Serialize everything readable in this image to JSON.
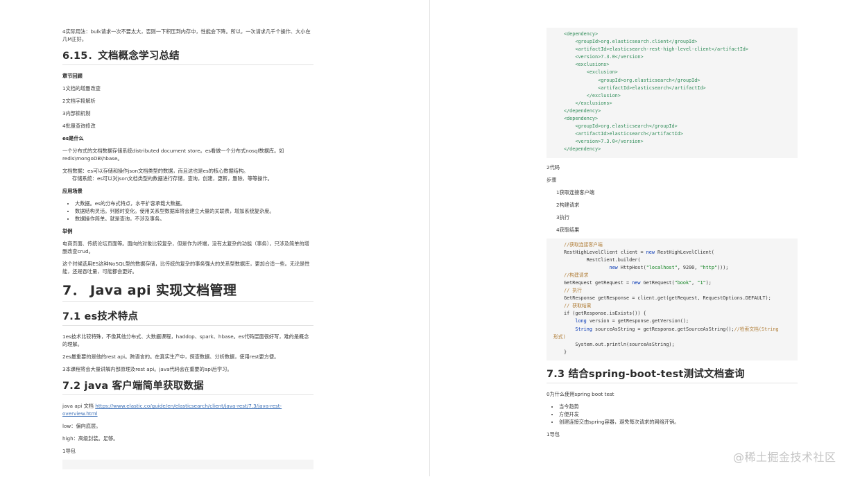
{
  "left": {
    "intro": "4实际用法：bulk请求一次不要太大，否则一下积压到内存中，性能会下降。所以，一次请求几千个操作、大小在几M正好。",
    "section_615": {
      "title": "6.15．文档概念学习总结",
      "recap_heading": "章节回顾",
      "recap_items": [
        "1文档的增删改查",
        "2文档字段解析",
        "3内部锁机制",
        "4批量查询修改"
      ],
      "what_heading": "es是什么",
      "what_p1": "一个分布式的文档数据存储系统distributed document store。es看做一个分布式nosql数据库。如redis\\mongoDB\\hbase。",
      "what_p2": "文档数据：es可以存储和操作json文档类型的数据，而且这也是es的核心数据结构。",
      "what_p3": "存储系统：es可以对json文档类型的数据进行存储，查询，创建，更新，删除，等等操作。",
      "scene_heading": "应用场景",
      "scene_items": [
        "大数据。es的分布式特点，水平扩容承载大数据。",
        "数据结构灵活。列随时变化。使用关系型数据库将会建立大量的关联表，增加系统复杂度。",
        "数据操作简单。就是查询，不涉及事务。"
      ],
      "example_heading": "举例",
      "example_p1": "电商页面、传统论坛页面等。面向的对象比较复杂，但是作为终端，没有太复杂的功能（事务），只涉及简单的增删改查crud。",
      "example_p2": "这个时候选用ES这种NoSQL型的数据存储，比传统的复杂的事务强大的关系型数据库，更加合适一些。无论是性能，还是吞吐量，可能都会更好。"
    },
    "chapter7": {
      "title": "7．  Java api 实现文档管理",
      "s71_title": "7.1 es技术特点",
      "s71_items": [
        "1es技术比较特殊，不像其他分布式、大数据课程，haddop、spark、hbase。es代码层面很好写，难的是概念的理解。",
        "2es最重要的是他的rest api。跨语言的。在真实生产中，探查数据、分析数据，使用rest更方便。",
        "3本课程将会大量讲解内部原理及rest api。java代码会在重要的api后学习。"
      ],
      "s72_title": "7.2 java 客户端简单获取数据",
      "doc_label": "java api 文档 ",
      "doc_url": "https://www.elastic.co/guide/en/elasticsearch/client/java-rest/7.3/java-rest-overview.html",
      "low": "low：偏向底层。",
      "high": "high：高级封装。足够。",
      "pkg": "1导包"
    }
  },
  "right": {
    "xml_lines": [
      "<dependency>",
      "    <groupId>org.elasticsearch.client</groupId>",
      "    <artifactId>elasticsearch-rest-high-level-client</artifactId>",
      "    <version>7.3.0</version>",
      "    <exclusions>",
      "        <exclusion>",
      "            <groupId>org.elasticsearch</groupId>",
      "            <artifactId>elasticsearch</artifactId>",
      "        </exclusion>",
      "    </exclusions>",
      "</dependency>",
      "<dependency>",
      "    <groupId>org.elasticsearch</groupId>",
      "    <artifactId>elasticsearch</artifactId>",
      "    <version>7.3.0</version>",
      "</dependency>"
    ],
    "code_label": "2代码",
    "steps_label": "步骤",
    "steps": [
      "1获取连接客户端",
      "2构建请求",
      "3执行",
      "4获取结果"
    ],
    "java": {
      "c1": "//获取连接客户端",
      "l1a": "RestHighLevelClient client = ",
      "l1kw": "new",
      "l1b": " RestHighLevelClient(",
      "l2": "        RestClient.builder(",
      "l3a": "                ",
      "l3kw": "new",
      "l3b": " HttpHost(",
      "l3s1": "\"localhost\"",
      "l3c": ", 9200, ",
      "l3s2": "\"http\"",
      "l3d": ")));",
      "c2": "//构建请求",
      "l4a": "GetRequest getRequest = ",
      "l4kw": "new",
      "l4b": " GetRequest(",
      "l4s1": "\"book\"",
      "l4c": ", ",
      "l4s2": "\"1\"",
      "l4d": ");",
      "c3": "// 执行",
      "l5": "GetResponse getResponse = client.get(getRequest, RequestOptions.DEFAULT);",
      "c4": "// 获取结果",
      "l6": "if (getResponse.isExists()) {",
      "l7kw": "long",
      "l7b": " version = getResponse.getVersion();",
      "l8kw": "String",
      "l8b": " sourceAsString = getResponse.getSourceAsString();",
      "l8c": "//检索文档(String",
      "l9c": "形式)",
      "l10": "    System.out.println(sourceAsString);",
      "l11": "}"
    },
    "s73_title": "7.3 结合spring-boot-test测试文档查询",
    "why": "0为什么使用spring boot test",
    "why_items": [
      "当今趋势",
      "方便开发",
      "创建连接交由spring容器，避免每次请求的网络开销。"
    ],
    "pkg": "1导包"
  },
  "watermark": "@稀土掘金技术社区"
}
